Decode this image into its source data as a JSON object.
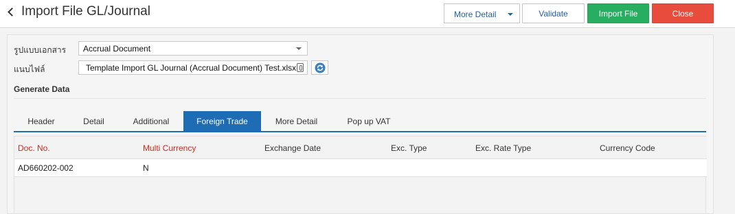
{
  "header": {
    "title": "Import File GL/Journal",
    "buttons": {
      "more_detail": "More Detail",
      "validate": "Validate",
      "import_file": "Import File",
      "close": "Close"
    }
  },
  "form": {
    "document_type_label": "รูปแบบเอกสาร",
    "document_type_value": "Accrual Document",
    "attach_file_label": "แนบไฟล์",
    "attach_file_value": "Template Import GL Journal (Accrual Document) Test.xlsx"
  },
  "section_title": "Generate Data",
  "tabs": [
    {
      "label": "Header",
      "active": false
    },
    {
      "label": "Detail",
      "active": false
    },
    {
      "label": "Additional",
      "active": false
    },
    {
      "label": "Foreign Trade",
      "active": true
    },
    {
      "label": "More Detail",
      "active": false
    },
    {
      "label": "Pop up VAT",
      "active": false
    }
  ],
  "table": {
    "columns": [
      {
        "label": "Doc. No.",
        "required": true
      },
      {
        "label": "Multi Currency",
        "required": true
      },
      {
        "label": "Exchange Date",
        "required": false
      },
      {
        "label": "Exc. Type",
        "required": false
      },
      {
        "label": "Exc. Rate Type",
        "required": false
      },
      {
        "label": "Currency Code",
        "required": false
      }
    ],
    "rows": [
      [
        "AD660202-002",
        "N",
        "",
        "",
        "",
        ""
      ]
    ]
  },
  "colors": {
    "accent_blue": "#1e6cb3",
    "import_green": "#27ae60",
    "close_red": "#e74c3c",
    "required_red": "#d9281c"
  }
}
